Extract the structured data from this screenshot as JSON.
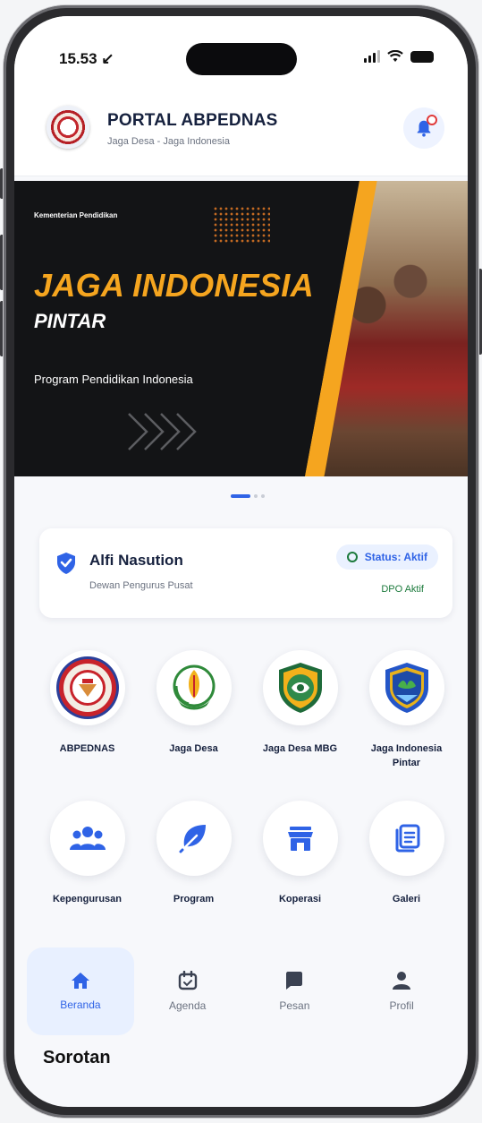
{
  "status_bar": {
    "time": "15.53 ↙"
  },
  "header": {
    "title": "PORTAL ABPEDNAS",
    "subtitle": "Jaga Desa - Jaga Indonesia"
  },
  "banner": {
    "kicker": "Kementerian Pendidikan",
    "title": "JAGA INDONESIA",
    "subtitle": "PINTAR",
    "caption": "Program Pendidikan Indonesia"
  },
  "user_card": {
    "name": "Alfi Nasution",
    "role": "Dewan Pengurus Pusat",
    "status": "Status: Aktif",
    "status_sub": "DPO Aktif"
  },
  "menu_rows": [
    [
      {
        "label": "ABPEDNAS",
        "icon": "abpednas-logo-icon"
      },
      {
        "label": "Jaga Desa",
        "icon": "jaga-desa-logo-icon"
      },
      {
        "label": "Jaga Desa MBG",
        "icon": "jaga-desa-mbg-logo-icon"
      },
      {
        "label": "Jaga Indonesia Pintar",
        "icon": "jaga-indonesia-pintar-logo-icon"
      }
    ],
    [
      {
        "label": "Kepengurusan",
        "icon": "people-icon"
      },
      {
        "label": "Program",
        "icon": "leaf-icon"
      },
      {
        "label": "Koperasi",
        "icon": "store-icon"
      },
      {
        "label": "Galeri",
        "icon": "document-icon"
      }
    ]
  ],
  "bottom_nav": [
    {
      "label": "Beranda",
      "icon": "home-icon",
      "active": true
    },
    {
      "label": "Agenda",
      "icon": "calendar-icon",
      "active": false
    },
    {
      "label": "Pesan",
      "icon": "message-icon",
      "active": false
    },
    {
      "label": "Profil",
      "icon": "user-icon",
      "active": false
    }
  ],
  "section_title": "Sorotan",
  "colors": {
    "accent": "#2f63e6",
    "banner_title": "#f5a51f",
    "status_green": "#1c7a3c"
  }
}
